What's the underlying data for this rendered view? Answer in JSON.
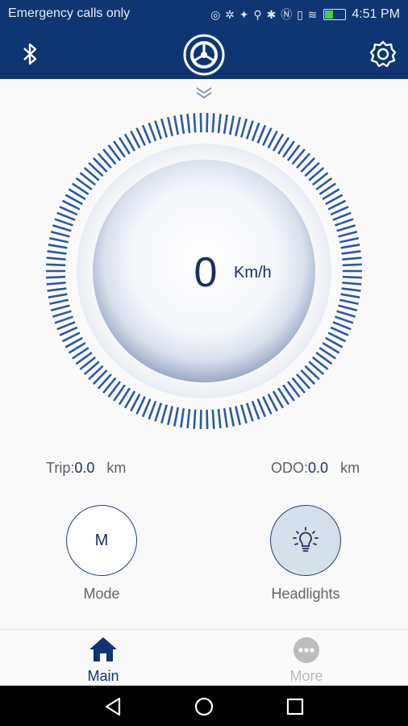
{
  "status_bar": {
    "carrier_text": "Emergency calls only",
    "time": "4:51 PM",
    "colors": {
      "background": "#0f3572",
      "battery_fill": "#41d34b"
    },
    "icons": [
      "sync-icon",
      "usb-icon",
      "location-icon",
      "bluetooth-icon",
      "nfc-icon",
      "vibrate-icon",
      "wifi-icon",
      "battery-icon"
    ]
  },
  "header": {
    "icons": {
      "left": "bluetooth-icon",
      "center": "wheel-logo-icon",
      "right": "settings-gear-icon"
    }
  },
  "speedometer": {
    "value": "0",
    "unit": "Km/h",
    "colors": {
      "tick": "#2b5aa0",
      "text": "#1b2f5c"
    }
  },
  "stats": {
    "trip_label": "Trip:",
    "trip_value": "0.0",
    "trip_unit": "km",
    "odo_label": "ODO:",
    "odo_value": "0.0",
    "odo_unit": "km"
  },
  "controls": {
    "mode_button_label": "M",
    "mode_caption": "Mode",
    "headlights_caption": "Headlights",
    "headlights_icon": "lightbulb-icon"
  },
  "bottom_nav": {
    "items": [
      {
        "label": "Main",
        "icon": "home-icon",
        "active": true
      },
      {
        "label": "More",
        "icon": "more-dots-icon",
        "active": false
      }
    ],
    "colors": {
      "active": "#0f3572",
      "inactive": "#b9b9b9"
    }
  },
  "system_nav": {
    "icons": [
      "back-icon",
      "home-circle-icon",
      "recents-icon"
    ]
  }
}
